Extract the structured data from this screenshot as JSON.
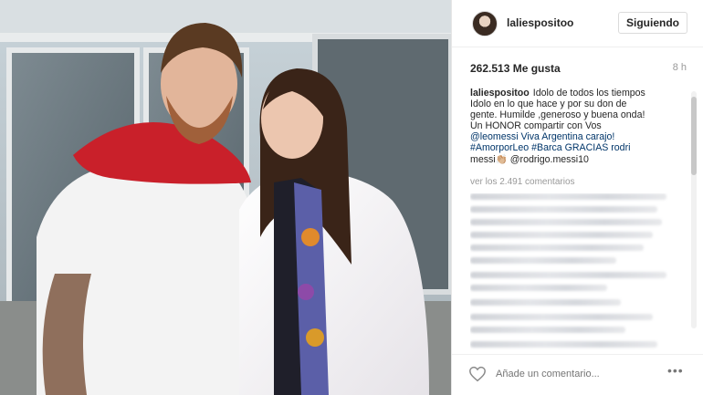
{
  "post": {
    "username": "laliespositoo",
    "follow_label": "Siguiendo",
    "likes": "262.513 Me gusta",
    "time": "8 h",
    "caption_user": "laliespositoo",
    "caption_lines": [
      "Idolo de todos los tiempos",
      "Idolo en lo que hace y por su don de",
      "gente. Humilde ,generoso y buena onda!",
      "Un HONOR compartir con Vos",
      "@leomessi Viva Argentina carajo!",
      "#AmorporLeo #Barca GRACIAS rodri",
      "messi👏🏼 @rodrigo.messi10"
    ],
    "view_comments": "ver los 2.491 comentarios",
    "comment_placeholder": "Añade un comentario...",
    "more_label": "•••"
  },
  "colors": {
    "link": "#003569",
    "muted": "#999999",
    "text": "#262626"
  },
  "icons": {
    "like": "heart-icon",
    "more": "more-options-icon"
  }
}
